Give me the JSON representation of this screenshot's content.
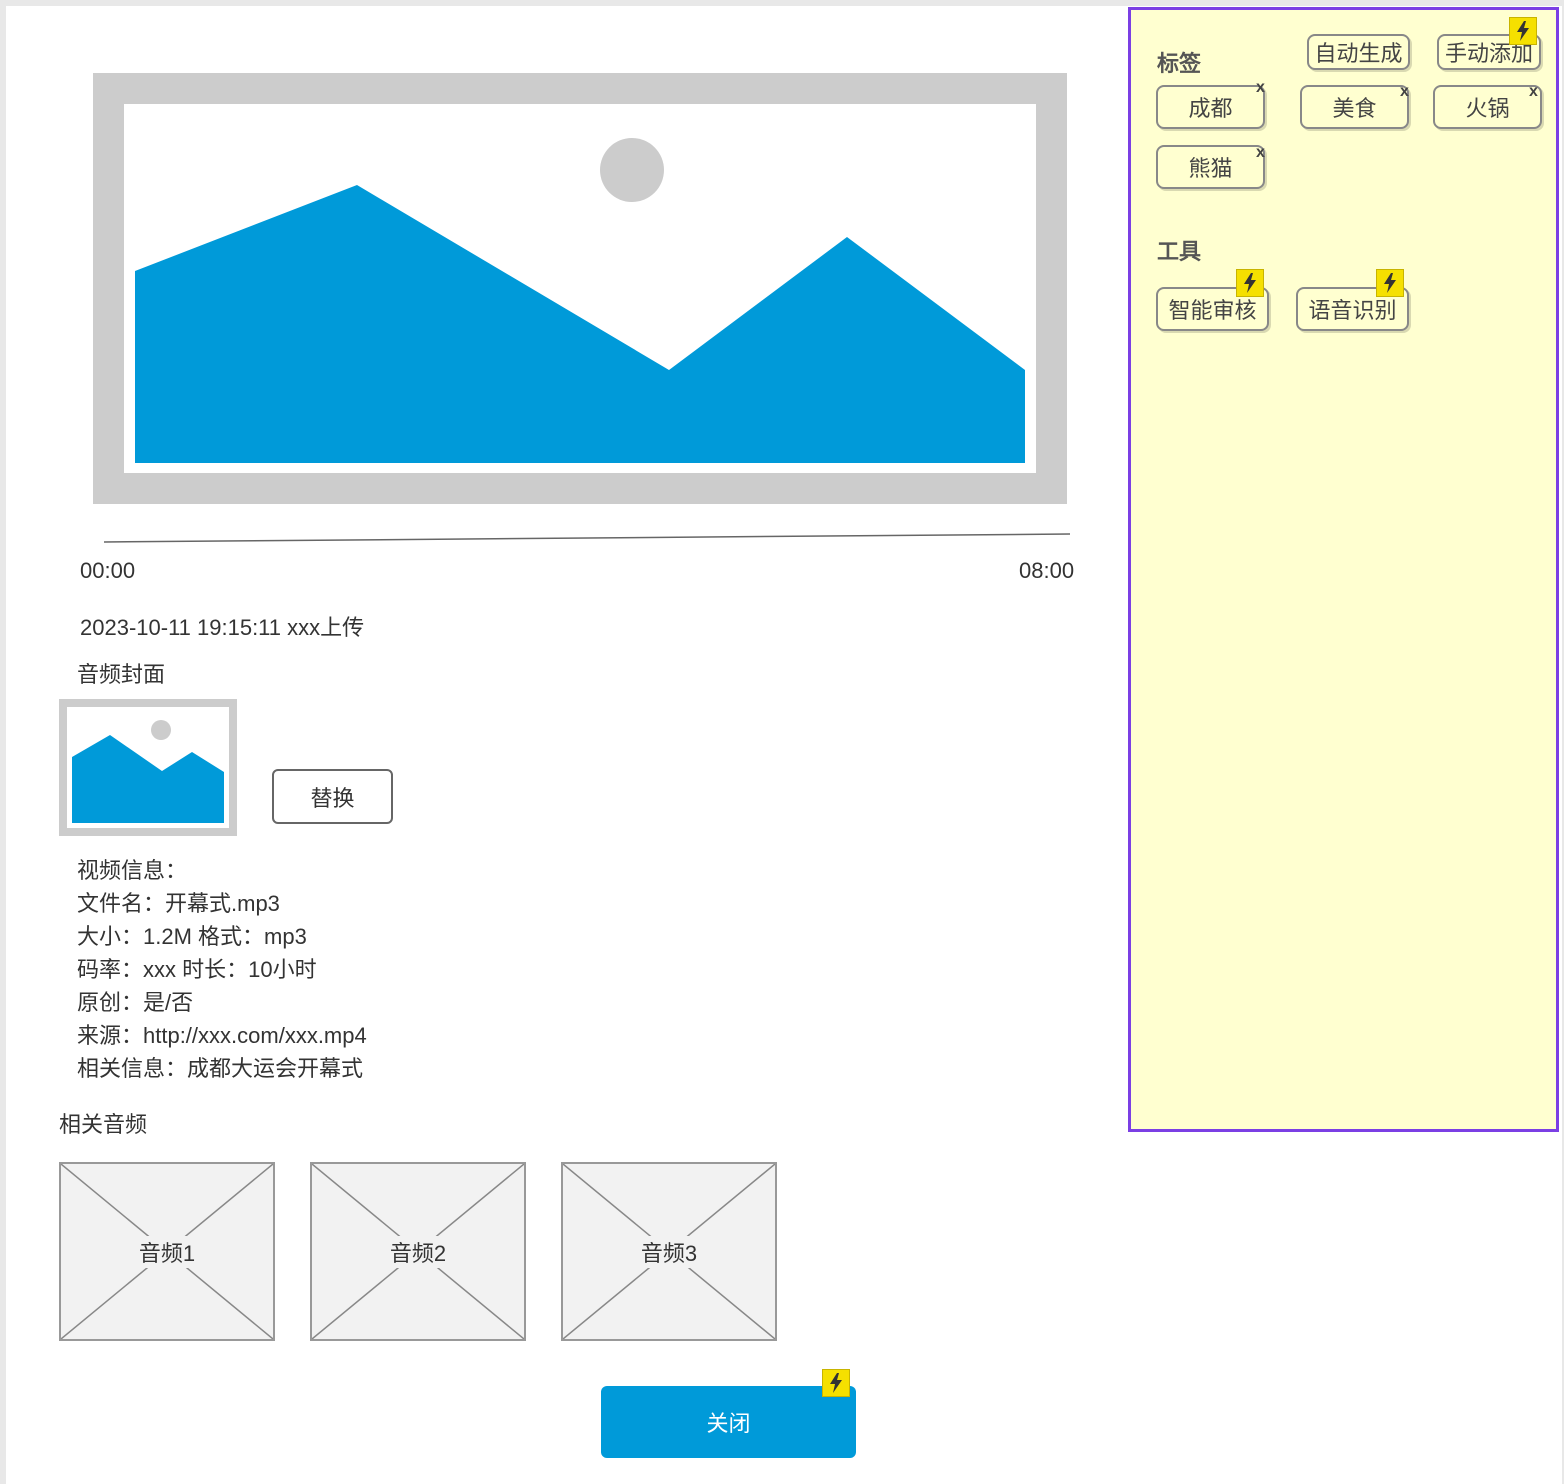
{
  "player": {
    "time_start": "00:00",
    "time_end": "08:00",
    "progress_fraction": 0
  },
  "upload_info": "2023-10-11 19:15:11  xxx上传",
  "cover": {
    "heading": "音频封面",
    "replace_label": "替换"
  },
  "video_info": {
    "heading": "视频信息：",
    "filename": "文件名：开幕式.mp3",
    "size_format": "大小：1.2M  格式：mp3",
    "bitrate_duration": "码率：xxx  时长：10小时",
    "original": "原创：是/否",
    "source": "来源：http://xxx.com/xxx.mp4",
    "related_info": "相关信息：成都大运会开幕式"
  },
  "related": {
    "heading": "相关音频",
    "items": [
      "音频1",
      "音频2",
      "音频3"
    ]
  },
  "close_label": "关闭",
  "panel": {
    "tags_heading": "标签",
    "auto_generate": "自动生成",
    "manual_add": "手动添加",
    "tags": [
      "成都",
      "美食",
      "火锅",
      "熊猫"
    ],
    "remove_mark": "x",
    "tools_heading": "工具",
    "tools": [
      "智能审核",
      "语音识别"
    ]
  },
  "colors": {
    "accent_blue": "#009ad9",
    "panel_bg": "#ffffd0",
    "panel_border": "#7b3fe4",
    "bolt_yellow": "#f5e000"
  }
}
